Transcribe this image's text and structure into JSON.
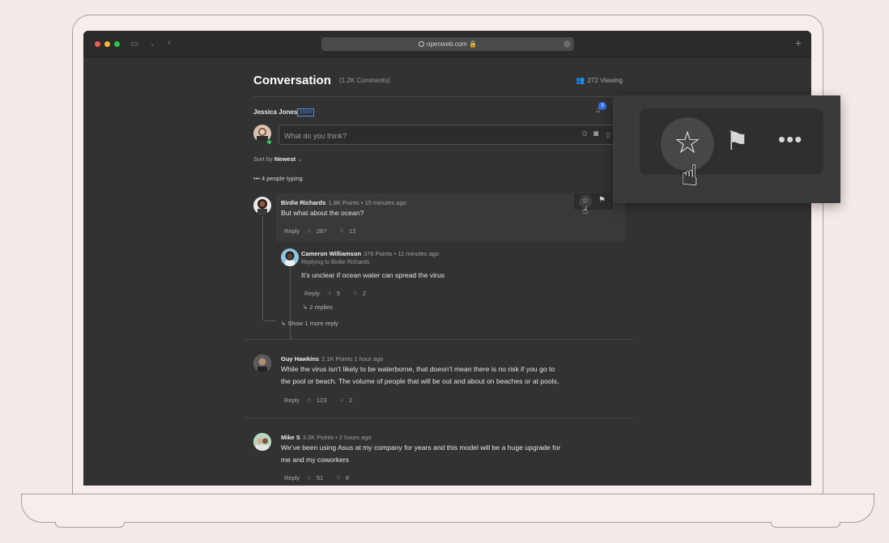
{
  "browser": {
    "url": "openweb.com",
    "plus_label": "+"
  },
  "conversation": {
    "title": "Conversation",
    "count": "(1.2K Comments)",
    "viewing": "272 Viewing",
    "notifications_count": "3"
  },
  "composer": {
    "user_name": "Jessica Jones",
    "staff_badge": "STAFF",
    "placeholder": "What do you think?"
  },
  "sort": {
    "label": "Sort by",
    "value": "Newest"
  },
  "typing": "4 people typing",
  "comments": [
    {
      "author": "Birdie Richards",
      "meta": "1.8K Points • 15 minutes ago",
      "body": "But what about the ocean?",
      "reply": "Reply",
      "likes": "287",
      "dislikes": "12"
    },
    {
      "author": "Cameron Williamson",
      "meta": "376 Points • 11 minutes ago",
      "reply_to": "Replying to Birdie Richards",
      "body": "It’s unclear if ocean water can spread the virus",
      "reply": "Reply",
      "likes": "5",
      "dislikes": "2",
      "replies_link": "2 replies"
    },
    {
      "author": "Guy Hawkins",
      "meta": "2.1K Points   1 hour ago",
      "body_line1": "While the virus isn’t likely to be waterborne, that doesn’t mean there is no risk if you go to",
      "body_line2": "the pool or beach. The volume of people that will be out and about on beaches or at pools,",
      "reply": "Reply",
      "likes": "123",
      "dislikes": "2"
    },
    {
      "author": "Mike S",
      "meta": "3.3K Points • 2 hours ago",
      "body_line1": "We’ve been using Asus at my company for years and this model will be a huge upgrade for",
      "body_line2": "me and my coworkers",
      "reply": "Reply",
      "likes": "51",
      "dislikes": "8"
    }
  ],
  "show_more": "Show 1 more reply",
  "icons": {
    "star": "☆",
    "flag": "⚑",
    "more": "•••",
    "cursor": "☝",
    "thumb_up": "👍",
    "thumb_down": "👎",
    "reply_arrow": "↳",
    "users": "👥",
    "bell": "🔔"
  },
  "colors": {
    "online": "#34c759",
    "badge": "#2f6df0",
    "staff": "#4b8df8"
  }
}
